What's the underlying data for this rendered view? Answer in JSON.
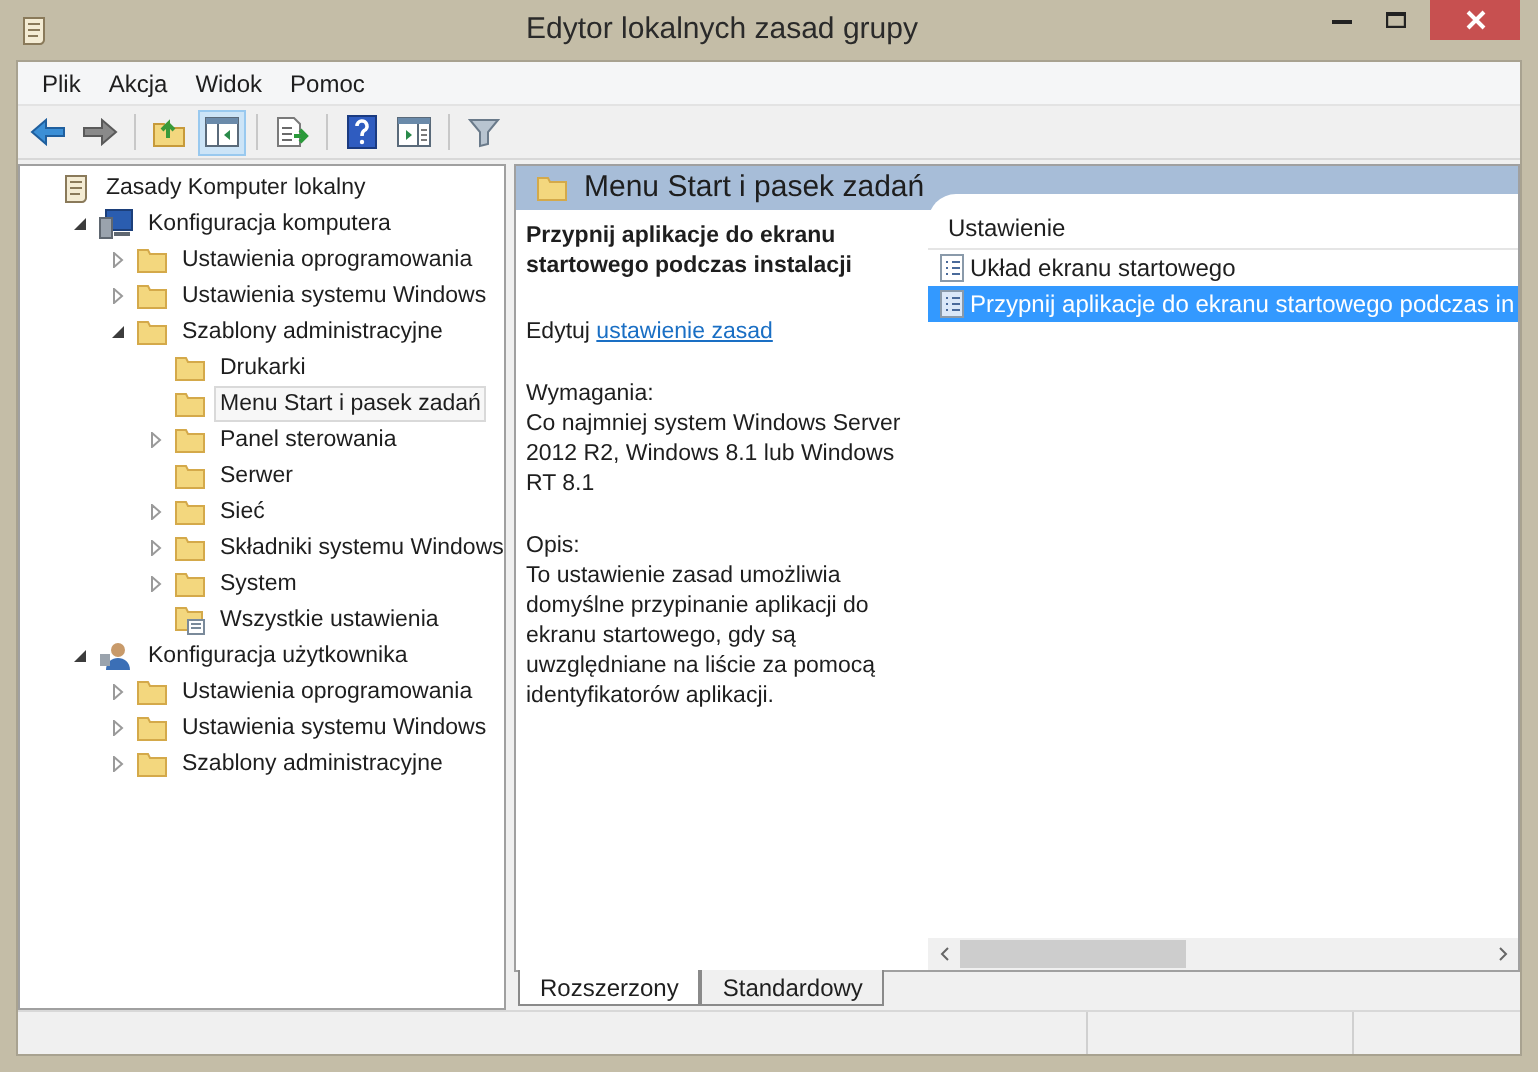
{
  "window": {
    "title": "Edytor lokalnych zasad grupy"
  },
  "menu": [
    "Plik",
    "Akcja",
    "Widok",
    "Pomoc"
  ],
  "toolbar": [
    {
      "kind": "back",
      "selected": false
    },
    {
      "kind": "forward",
      "selected": false
    },
    {
      "kind": "sep"
    },
    {
      "kind": "up",
      "selected": false
    },
    {
      "kind": "tree",
      "selected": true
    },
    {
      "kind": "sep"
    },
    {
      "kind": "export",
      "selected": false
    },
    {
      "kind": "sep"
    },
    {
      "kind": "help",
      "selected": false
    },
    {
      "kind": "properties",
      "selected": false
    },
    {
      "kind": "sep"
    },
    {
      "kind": "filter",
      "selected": false
    }
  ],
  "tree": [
    {
      "label": "Zasady Komputer lokalny",
      "kind": "policy",
      "selected": false,
      "children": [
        {
          "label": "Konfiguracja komputera",
          "kind": "computer",
          "expanded": true,
          "selected": false,
          "children": [
            {
              "label": "Ustawienia oprogramowania",
              "kind": "folder",
              "expanded": false,
              "selected": false
            },
            {
              "label": "Ustawienia systemu Windows",
              "kind": "folder",
              "expanded": false,
              "selected": false
            },
            {
              "label": "Szablony administracyjne",
              "kind": "folder",
              "expanded": true,
              "selected": false,
              "children": [
                {
                  "label": "Drukarki",
                  "kind": "folder",
                  "selected": false
                },
                {
                  "label": "Menu Start i pasek zadań",
                  "kind": "folder",
                  "selected": true
                },
                {
                  "label": "Panel sterowania",
                  "kind": "folder",
                  "expanded": false,
                  "selected": false
                },
                {
                  "label": "Serwer",
                  "kind": "folder",
                  "selected": false
                },
                {
                  "label": "Sieć",
                  "kind": "folder",
                  "expanded": false,
                  "selected": false
                },
                {
                  "label": "Składniki systemu Windows",
                  "kind": "folder",
                  "expanded": false,
                  "selected": false
                },
                {
                  "label": "System",
                  "kind": "folder",
                  "expanded": false,
                  "selected": false
                },
                {
                  "label": "Wszystkie ustawienia",
                  "kind": "settings",
                  "selected": false
                }
              ]
            }
          ]
        },
        {
          "label": "Konfiguracja użytkownika",
          "kind": "user",
          "expanded": true,
          "selected": false,
          "children": [
            {
              "label": "Ustawienia oprogramowania",
              "kind": "folder",
              "expanded": false,
              "selected": false
            },
            {
              "label": "Ustawienia systemu Windows",
              "kind": "folder",
              "expanded": false,
              "selected": false
            },
            {
              "label": "Szablony administracyjne",
              "kind": "folder",
              "expanded": false,
              "selected": false
            }
          ]
        }
      ]
    }
  ],
  "details": {
    "header": "Menu Start i pasek zadań",
    "policy_title": "Przypnij aplikacje do ekranu startowego podczas instalacji",
    "edit_label": "Edytuj",
    "edit_link": "ustawienie zasad",
    "requirements_label": "Wymagania:",
    "requirements": "Co najmniej system Windows Server 2012 R2, Windows 8.1 lub Windows RT 8.1",
    "description_label": "Opis:",
    "description": "To ustawienie zasad umożliwia domyślne przypinanie aplikacji do ekranu startowego, gdy są uwzględniane na liście za pomocą identyfikatorów aplikacji."
  },
  "list": {
    "column": "Ustawienie",
    "rows": [
      {
        "label": "Układ ekranu startowego",
        "selected": false
      },
      {
        "label": "Przypnij aplikacje do ekranu startowego podczas in",
        "selected": true
      }
    ]
  },
  "tabs": [
    {
      "label": "Rozszerzony",
      "selected": true
    },
    {
      "label": "Standardowy",
      "selected": false
    }
  ]
}
